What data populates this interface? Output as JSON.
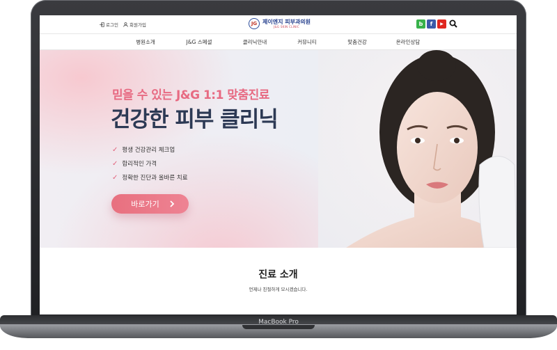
{
  "device": {
    "label": "MacBook Pro"
  },
  "header": {
    "login_label": "로그인",
    "signup_label": "회원가입",
    "logo_name": "제이엔지 피부과의원",
    "logo_sub": "J&G SKIN CLINIC",
    "logo_mark": "JG",
    "social": [
      {
        "icon": "blog-icon",
        "label": "b",
        "color": "#38b24a"
      },
      {
        "icon": "facebook-icon",
        "label": "f",
        "color": "#3b5aa8"
      },
      {
        "icon": "youtube-icon",
        "label": "▶",
        "color": "#e0261f"
      }
    ]
  },
  "nav": {
    "items": [
      {
        "label": "병원소개"
      },
      {
        "label": "J&G 스페셜"
      },
      {
        "label": "클리닉안내"
      },
      {
        "label": "커뮤니티"
      },
      {
        "label": "맞춤건강"
      },
      {
        "label": "온라인상담"
      }
    ]
  },
  "hero": {
    "subtitle": "믿을 수 있는 J&G 1:1 맞춤진료",
    "title": "건강한 피부 클리닉",
    "checklist": [
      {
        "label": "평생 건강관리 체크업"
      },
      {
        "label": "합리적인 가격"
      },
      {
        "label": "정확한 진단과 올바른 치료"
      }
    ],
    "cta_label": "바로가기",
    "cta_icon": "chevron-right-icon"
  },
  "section": {
    "title": "진료 소개",
    "description": "언제나 친절하게 모시겠습니다."
  },
  "colors": {
    "accent": "#e76a82",
    "title": "#2c3954",
    "logo": "#27418e"
  }
}
